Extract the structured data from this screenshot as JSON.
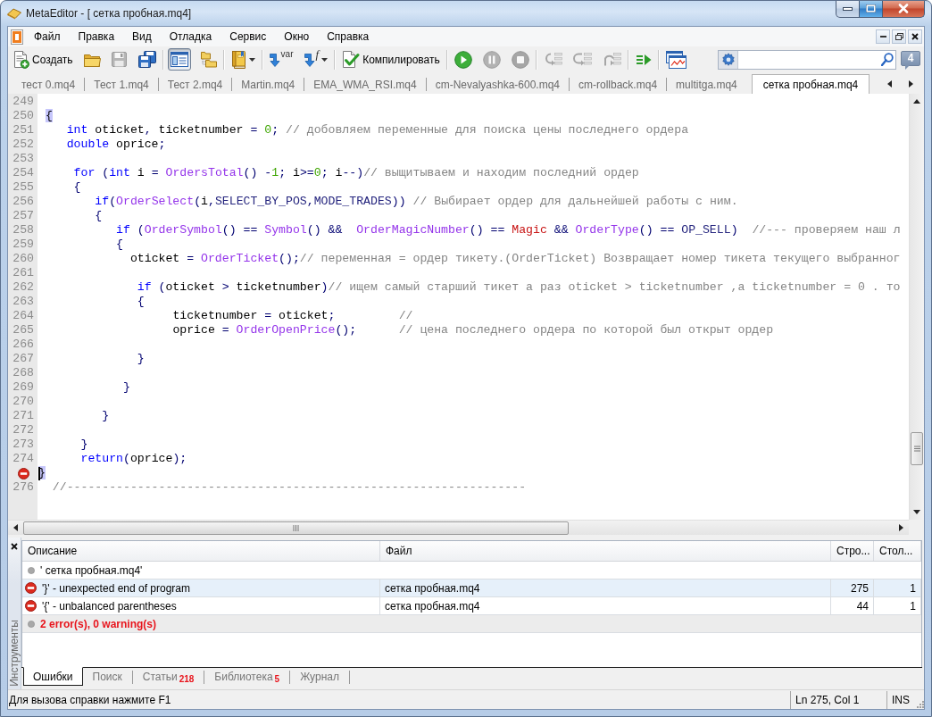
{
  "window": {
    "title": "MetaEditor - [ сетка пробная.mq4]"
  },
  "menu": [
    "Файл",
    "Правка",
    "Вид",
    "Отладка",
    "Сервис",
    "Окно",
    "Справка"
  ],
  "toolbar": {
    "groups": [
      {
        "buttons": [
          {
            "kind": "new",
            "label": "Создать",
            "disabled": false,
            "pressed": false
          },
          {
            "kind": "open",
            "disabled": false,
            "pressed": false
          },
          {
            "kind": "save",
            "disabled": true,
            "pressed": false
          },
          {
            "kind": "save-all",
            "disabled": false,
            "pressed": false
          }
        ]
      },
      {
        "buttons": [
          {
            "kind": "navigator",
            "disabled": false,
            "pressed": true
          },
          {
            "kind": "files",
            "disabled": false,
            "pressed": false
          }
        ]
      },
      {
        "buttons": [
          {
            "kind": "book",
            "disabled": false,
            "pressed": false
          }
        ]
      },
      {
        "buttons": [
          {
            "kind": "variable",
            "label": "var",
            "disabled": false,
            "pressed": false
          },
          {
            "kind": "function",
            "label": "f",
            "disabled": false,
            "pressed": false
          }
        ]
      },
      {
        "buttons": [
          {
            "kind": "compile",
            "label": "Компилировать",
            "disabled": false,
            "pressed": false
          }
        ]
      },
      {
        "buttons": [
          {
            "kind": "start",
            "disabled": false,
            "pressed": false
          },
          {
            "kind": "pause",
            "disabled": true,
            "pressed": false
          },
          {
            "kind": "stop",
            "disabled": true,
            "pressed": false
          }
        ]
      },
      {
        "buttons": [
          {
            "kind": "step-into",
            "disabled": true,
            "pressed": false
          },
          {
            "kind": "step-over",
            "disabled": true,
            "pressed": false
          },
          {
            "kind": "step-out",
            "disabled": true,
            "pressed": false
          }
        ]
      },
      {
        "buttons": [
          {
            "kind": "run-to",
            "disabled": false,
            "pressed": false
          }
        ]
      },
      {
        "buttons": [
          {
            "kind": "chart",
            "disabled": false,
            "pressed": false
          }
        ]
      }
    ],
    "messages_count": "4"
  },
  "tabs": [
    {
      "label": "тест 0.mq4",
      "selected": false
    },
    {
      "label": "Тест 1.mq4",
      "selected": false
    },
    {
      "label": "Тест 2.mq4",
      "selected": false
    },
    {
      "label": "Martin.mq4",
      "selected": false
    },
    {
      "label": "EMA_WMA_RSI.mq4",
      "selected": false
    },
    {
      "label": "cm-Nevalyashka-600.mq4",
      "selected": false
    },
    {
      "label": "cm-rollback.mq4",
      "selected": false
    },
    {
      "label": "multitga.mq4",
      "selected": false
    },
    {
      "label": "сетка пробная.mq4",
      "selected": true
    }
  ],
  "editor": {
    "lines": [
      {
        "number": "249",
        "error": false,
        "cursor": false
      },
      {
        "number": "250",
        "error": false,
        "cursor": false,
        "tokens": [
          {
            "kind": "matched-brace",
            "text": " {"
          }
        ]
      },
      {
        "number": "251",
        "error": false,
        "cursor": false,
        "tokens": [
          {
            "kind": "keyword",
            "text": "    int"
          },
          {
            "kind": "plain",
            "text": " oticket"
          },
          {
            "kind": "operator",
            "text": ", "
          },
          {
            "kind": "plain",
            "text": "ticketnumber "
          },
          {
            "kind": "operator",
            "text": "= "
          },
          {
            "kind": "number",
            "text": "0"
          },
          {
            "kind": "operator",
            "text": "; "
          },
          {
            "kind": "comment",
            "text": "// добовляем переменные для поиска цены последнего ордера"
          }
        ]
      },
      {
        "number": "252",
        "error": false,
        "cursor": false,
        "tokens": [
          {
            "kind": "keyword",
            "text": "    double"
          },
          {
            "kind": "plain",
            "text": " oprice"
          },
          {
            "kind": "operator",
            "text": ";"
          }
        ]
      },
      {
        "number": "253",
        "error": false,
        "cursor": false
      },
      {
        "number": "254",
        "error": false,
        "cursor": false,
        "tokens": [
          {
            "kind": "keyword",
            "text": "     for"
          },
          {
            "kind": "operator",
            "text": " ("
          },
          {
            "kind": "keyword",
            "text": "int"
          },
          {
            "kind": "plain",
            "text": " i "
          },
          {
            "kind": "operator",
            "text": "= "
          },
          {
            "kind": "function",
            "text": "OrdersTotal"
          },
          {
            "kind": "operator",
            "text": "() -"
          },
          {
            "kind": "number",
            "text": "1"
          },
          {
            "kind": "operator",
            "text": "; "
          },
          {
            "kind": "plain",
            "text": "i"
          },
          {
            "kind": "operator",
            "text": ">="
          },
          {
            "kind": "number",
            "text": "0"
          },
          {
            "kind": "operator",
            "text": "; "
          },
          {
            "kind": "plain",
            "text": "i"
          },
          {
            "kind": "operator",
            "text": "--)"
          },
          {
            "kind": "comment",
            "text": "// выщитываем и находим последний ордер"
          }
        ]
      },
      {
        "number": "255",
        "error": false,
        "cursor": false,
        "tokens": [
          {
            "kind": "operator",
            "text": "     {"
          }
        ]
      },
      {
        "number": "256",
        "error": false,
        "cursor": false,
        "tokens": [
          {
            "kind": "keyword",
            "text": "        if"
          },
          {
            "kind": "operator",
            "text": "("
          },
          {
            "kind": "function",
            "text": "OrderSelect"
          },
          {
            "kind": "operator",
            "text": "("
          },
          {
            "kind": "plain",
            "text": "i"
          },
          {
            "kind": "operator",
            "text": ","
          },
          {
            "kind": "constant",
            "text": "SELECT_BY_POS"
          },
          {
            "kind": "operator",
            "text": ","
          },
          {
            "kind": "constant",
            "text": "MODE_TRADES"
          },
          {
            "kind": "operator",
            "text": ")) "
          },
          {
            "kind": "comment",
            "text": "// Выбирает ордер для дальнейшей работы с ним."
          }
        ]
      },
      {
        "number": "257",
        "error": false,
        "cursor": false,
        "tokens": [
          {
            "kind": "operator",
            "text": "        {"
          }
        ]
      },
      {
        "number": "258",
        "error": false,
        "cursor": false,
        "tokens": [
          {
            "kind": "keyword",
            "text": "           if"
          },
          {
            "kind": "operator",
            "text": " ("
          },
          {
            "kind": "function",
            "text": "OrderSymbol"
          },
          {
            "kind": "operator",
            "text": "() == "
          },
          {
            "kind": "function",
            "text": "Symbol"
          },
          {
            "kind": "operator",
            "text": "() &&  "
          },
          {
            "kind": "function",
            "text": "OrderMagicNumber"
          },
          {
            "kind": "operator",
            "text": "() == "
          },
          {
            "kind": "input",
            "text": "Magic"
          },
          {
            "kind": "operator",
            "text": " && "
          },
          {
            "kind": "function",
            "text": "OrderType"
          },
          {
            "kind": "operator",
            "text": "() == "
          },
          {
            "kind": "constant",
            "text": "OP_SELL"
          },
          {
            "kind": "operator",
            "text": ")  "
          },
          {
            "kind": "comment",
            "text": "//--- проверяем наш л"
          }
        ]
      },
      {
        "number": "259",
        "error": false,
        "cursor": false,
        "tokens": [
          {
            "kind": "operator",
            "text": "           {"
          }
        ]
      },
      {
        "number": "260",
        "error": false,
        "cursor": false,
        "tokens": [
          {
            "kind": "plain",
            "text": "             oticket "
          },
          {
            "kind": "operator",
            "text": "= "
          },
          {
            "kind": "function",
            "text": "OrderTicket"
          },
          {
            "kind": "operator",
            "text": "();"
          },
          {
            "kind": "comment",
            "text": "// переменная = ордер тикету.(OrderTicket) Возвращает номер тикета текущего выбранног"
          }
        ]
      },
      {
        "number": "261",
        "error": false,
        "cursor": false
      },
      {
        "number": "262",
        "error": false,
        "cursor": false,
        "tokens": [
          {
            "kind": "keyword",
            "text": "              if"
          },
          {
            "kind": "operator",
            "text": " ("
          },
          {
            "kind": "plain",
            "text": "oticket "
          },
          {
            "kind": "operator",
            "text": "> "
          },
          {
            "kind": "plain",
            "text": "ticketnumber"
          },
          {
            "kind": "operator",
            "text": ")"
          },
          {
            "kind": "comment",
            "text": "// ищем самый старший тикет а раз oticket > ticketnumber ,а ticketnumber = 0 . то"
          }
        ]
      },
      {
        "number": "263",
        "error": false,
        "cursor": false,
        "tokens": [
          {
            "kind": "operator",
            "text": "              {"
          }
        ]
      },
      {
        "number": "264",
        "error": false,
        "cursor": false,
        "tokens": [
          {
            "kind": "plain",
            "text": "                   ticketnumber "
          },
          {
            "kind": "operator",
            "text": "= "
          },
          {
            "kind": "plain",
            "text": "oticket"
          },
          {
            "kind": "operator",
            "text": ";         "
          },
          {
            "kind": "comment",
            "text": "//"
          }
        ]
      },
      {
        "number": "265",
        "error": false,
        "cursor": false,
        "tokens": [
          {
            "kind": "plain",
            "text": "                   oprice "
          },
          {
            "kind": "operator",
            "text": "= "
          },
          {
            "kind": "function",
            "text": "OrderOpenPrice"
          },
          {
            "kind": "operator",
            "text": "();      "
          },
          {
            "kind": "comment",
            "text": "// цена последнего ордера по которой был открыт ордер"
          }
        ]
      },
      {
        "number": "266",
        "error": false,
        "cursor": false
      },
      {
        "number": "267",
        "error": false,
        "cursor": false,
        "tokens": [
          {
            "kind": "operator",
            "text": "              }"
          }
        ]
      },
      {
        "number": "268",
        "error": false,
        "cursor": false
      },
      {
        "number": "269",
        "error": false,
        "cursor": false,
        "tokens": [
          {
            "kind": "operator",
            "text": "            }"
          }
        ]
      },
      {
        "number": "270",
        "error": false,
        "cursor": false
      },
      {
        "number": "271",
        "error": false,
        "cursor": false,
        "tokens": [
          {
            "kind": "operator",
            "text": "         }"
          }
        ]
      },
      {
        "number": "272",
        "error": false,
        "cursor": false
      },
      {
        "number": "273",
        "error": false,
        "cursor": false,
        "tokens": [
          {
            "kind": "operator",
            "text": "      }"
          }
        ]
      },
      {
        "number": "274",
        "error": false,
        "cursor": false,
        "tokens": [
          {
            "kind": "keyword",
            "text": "      return"
          },
          {
            "kind": "operator",
            "text": "("
          },
          {
            "kind": "plain",
            "text": "oprice"
          },
          {
            "kind": "operator",
            "text": ");"
          }
        ]
      },
      {
        "error": true,
        "cursor": true,
        "tokens": [
          {
            "kind": "matched-brace",
            "text": "}"
          }
        ]
      },
      {
        "number": "276",
        "error": false,
        "cursor": false,
        "tokens": [
          {
            "kind": "comment",
            "text": "  //-----------------------------------------------------------------"
          }
        ]
      }
    ]
  },
  "toolbox": {
    "title": "Инструменты",
    "columns": [
      "Описание",
      "Файл",
      "Стро...",
      "Стол..."
    ],
    "rows": [
      {
        "kind": "info",
        "selected": false,
        "cells": [
          "' сетка пробная.mq4'"
        ]
      },
      {
        "kind": "error",
        "selected": true,
        "cells": [
          "'}' - unexpected end of program",
          "сетка пробная.mq4",
          "275",
          "1"
        ]
      },
      {
        "kind": "error",
        "selected": false,
        "cells": [
          "'{' - unbalanced parentheses",
          "сетка пробная.mq4",
          "44",
          "1"
        ]
      },
      {
        "kind": "summary",
        "selected": false,
        "cells": [
          "2 error(s), 0 warning(s)"
        ]
      }
    ],
    "tabs": [
      {
        "label": "Ошибки",
        "selected": true
      },
      {
        "label": "Поиск",
        "selected": false
      },
      {
        "label": "Статьи",
        "count": "218",
        "selected": false
      },
      {
        "label": "Библиотека",
        "count": "5",
        "selected": false
      },
      {
        "label": "Журнал",
        "selected": false
      }
    ]
  },
  "status_bar": {
    "hint": "Для вызова справки нажмите F1",
    "position": "Ln 275, Col 1",
    "mode": "INS"
  }
}
